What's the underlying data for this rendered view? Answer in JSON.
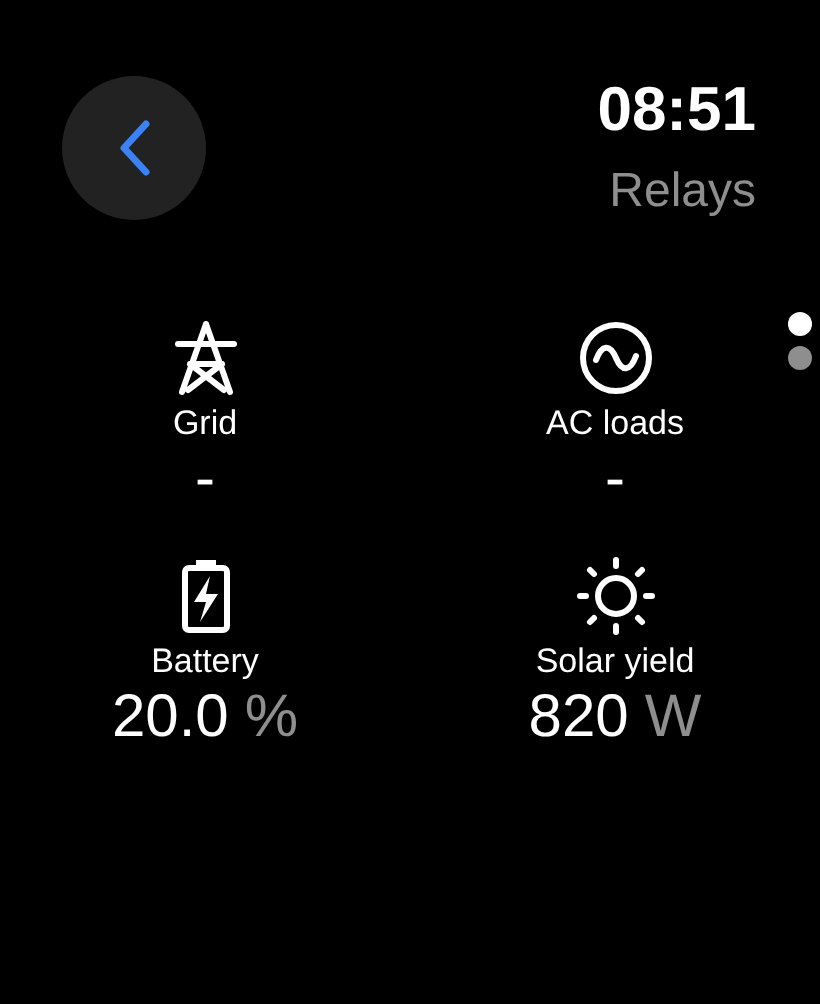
{
  "header": {
    "time": "08:51",
    "title": "Relays"
  },
  "page_dots": [
    {
      "selected": true
    },
    {
      "selected": false
    }
  ],
  "tiles": [
    {
      "kind": "grid",
      "label": "Grid",
      "value": "-"
    },
    {
      "kind": "ac",
      "label": "AC loads",
      "value": "-"
    },
    {
      "kind": "battery",
      "label": "Battery",
      "value": "20.0",
      "unit": "%"
    },
    {
      "kind": "solar",
      "label": "Solar yield",
      "value": "820",
      "unit": "W"
    }
  ]
}
